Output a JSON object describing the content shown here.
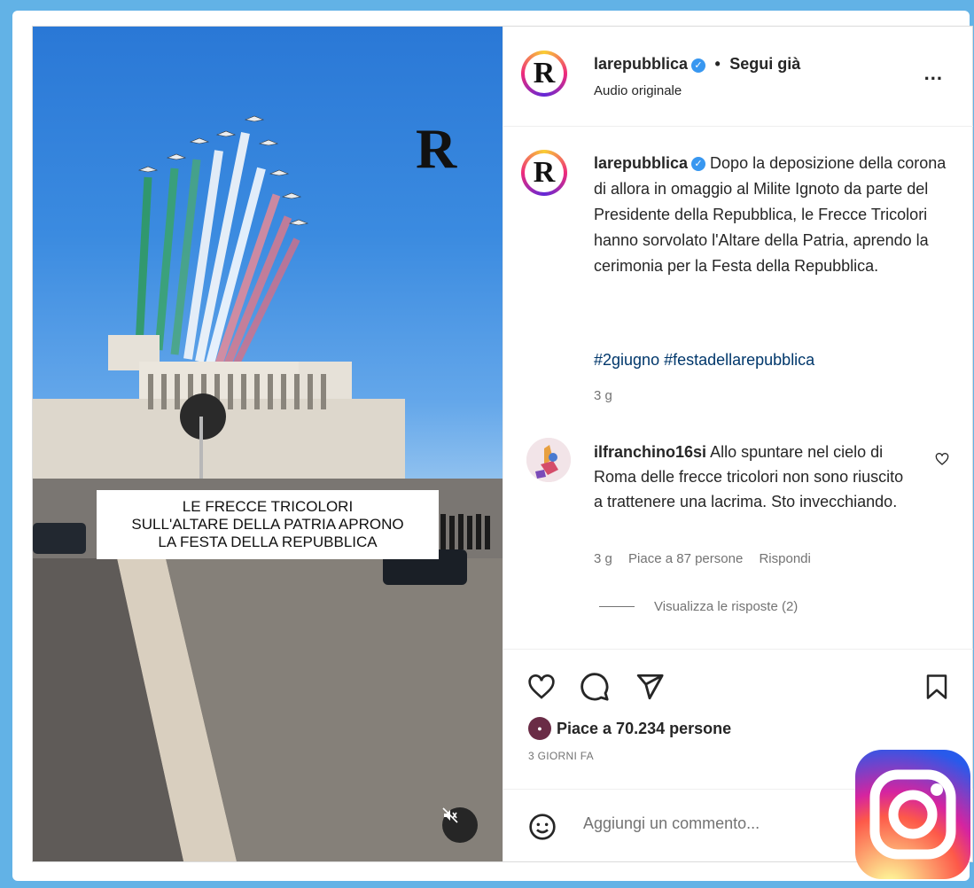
{
  "media": {
    "logo_letter": "R",
    "overlay_caption": "LE FRECCE TRICOLORI\nSULL'ALTARE DELLA PATRIA APRONO\nLA FESTA DELLA REPUBBLICA"
  },
  "header": {
    "avatar_letter": "R",
    "username": "larepubblica",
    "separator": "•",
    "follow_label": "Segui già",
    "subtitle": "Audio originale",
    "more_label": "..."
  },
  "caption": {
    "avatar_letter": "R",
    "username": "larepubblica",
    "text": "Dopo la deposizione della corona di allora in omaggio al Milite Ignoto da parte del Presidente della Repubblica, le Frecce Tricolori hanno sorvolato l'Altare della Patria, aprendo la cerimonia per la Festa della Repubblica.",
    "hashtags": "#2giugno #festadellarepubblica",
    "time": "3 g"
  },
  "comment": {
    "username": "ilfranchino16si",
    "text": "Allo spuntare nel cielo di Roma delle frecce tricolori non sono riuscito a trattenere una lacrima. Sto invecchiando.",
    "time": "3 g",
    "likes": "Piace a 87 persone",
    "reply_label": "Rispondi",
    "view_replies": "Visualizza le risposte (2)"
  },
  "actions": {
    "icons": [
      "heart-icon",
      "comment-icon",
      "share-icon",
      "bookmark-icon"
    ],
    "likes_text": "Piace a 70.234 persone",
    "date": "3 GIORNI FA"
  },
  "add_comment": {
    "placeholder": "Aggiungi un commento..."
  },
  "colors": {
    "background": "#62b2e6",
    "link": "#00376b",
    "verified": "#3897f0"
  }
}
